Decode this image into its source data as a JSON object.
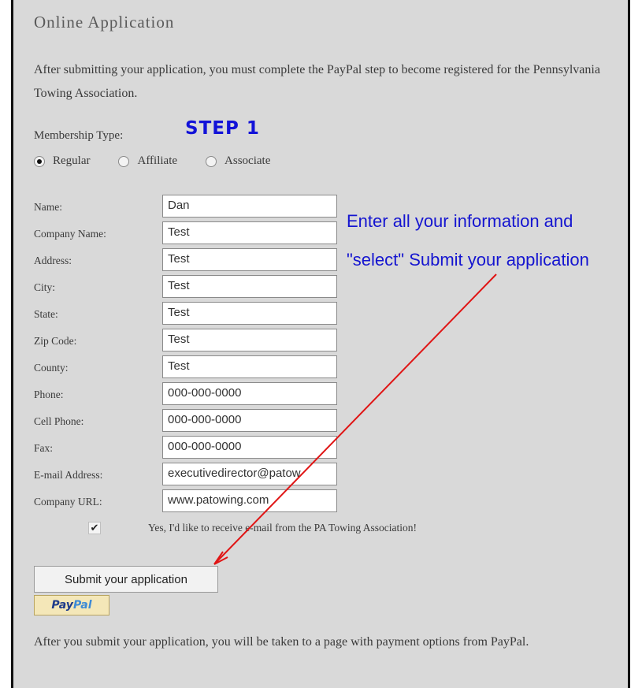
{
  "form": {
    "heading": "Online Application",
    "intro": "After submitting your application, you must complete the PayPal step to become registered for the Pennsylvania Towing Association.",
    "membership_label": "Membership Type:",
    "membership_options": [
      {
        "label": "Regular",
        "selected": true
      },
      {
        "label": "Affiliate",
        "selected": false
      },
      {
        "label": "Associate",
        "selected": false
      }
    ],
    "fields": [
      {
        "label": "Name:",
        "value": "Dan"
      },
      {
        "label": "Company Name:",
        "value": "Test"
      },
      {
        "label": "Address:",
        "value": "Test"
      },
      {
        "label": "City:",
        "value": "Test"
      },
      {
        "label": "State:",
        "value": "Test"
      },
      {
        "label": "Zip Code:",
        "value": "Test"
      },
      {
        "label": "County:",
        "value": "Test"
      },
      {
        "label": "Phone:",
        "value": "000-000-0000"
      },
      {
        "label": "Cell Phone:",
        "value": "000-000-0000"
      },
      {
        "label": "Fax:",
        "value": "000-000-0000"
      },
      {
        "label": "E-mail Address:",
        "value": "executivedirector@patow"
      },
      {
        "label": "Company URL:",
        "value": "www.patowing.com"
      }
    ],
    "optin_checked": true,
    "optin_label": "Yes, I'd like to receive e-mail from the PA Towing Association!",
    "submit_label": "Submit your application",
    "paypal_pay": "Pay",
    "paypal_pal": "Pal",
    "outro": "After you submit your application, you will be taken to a page with payment options from PayPal."
  },
  "annotations": {
    "step": "STEP 1",
    "line1": "Enter all your information and",
    "line2": "\"select\" Submit your application",
    "text_color": "#1515d0",
    "arrow_color": "#e01515"
  }
}
